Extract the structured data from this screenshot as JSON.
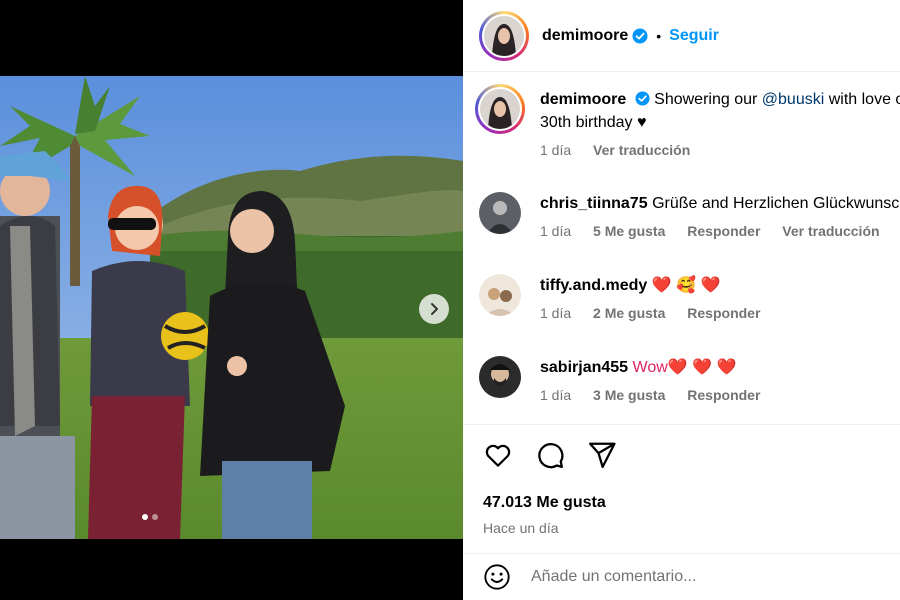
{
  "post": {
    "author": "demimoore",
    "follow_label": "Seguir",
    "separator": "•",
    "verified_color": "#0095f6",
    "accent": "#0095f6"
  },
  "media": {
    "slide_count": 2,
    "active_slide": 1,
    "next_icon": "chevron-right-icon"
  },
  "comments": [
    {
      "user": "demimoore",
      "verified": true,
      "text_before": "Showering our ",
      "mention": "@buuski",
      "text_after": " with love on her",
      "text_line2": "30th birthday ♥",
      "age": "1 día",
      "translate": "Ver traducción"
    },
    {
      "user": "chris_tiinna75",
      "text": "Grüße and Herzlichen Glückwunsch",
      "age": "1 día",
      "likes": "5 Me gusta",
      "reply": "Responder",
      "translate": "Ver traducción"
    },
    {
      "user": "tiffy.and.medy",
      "text": "❤️ 🥰 ❤️",
      "age": "1 día",
      "likes": "2 Me gusta",
      "reply": "Responder"
    },
    {
      "user": "sabirjan455",
      "text": "Wow❤️ ❤️ ❤️",
      "age": "1 día",
      "likes": "3 Me gusta",
      "reply": "Responder"
    }
  ],
  "actions": {
    "like_icon": "heart-icon",
    "comment_icon": "comment-icon",
    "share_icon": "send-icon"
  },
  "stats": {
    "likes": "47.013 Me gusta",
    "posted": "Hace un día"
  },
  "composer": {
    "emoji_icon": "smiley-icon",
    "placeholder": "Añade un comentario..."
  }
}
